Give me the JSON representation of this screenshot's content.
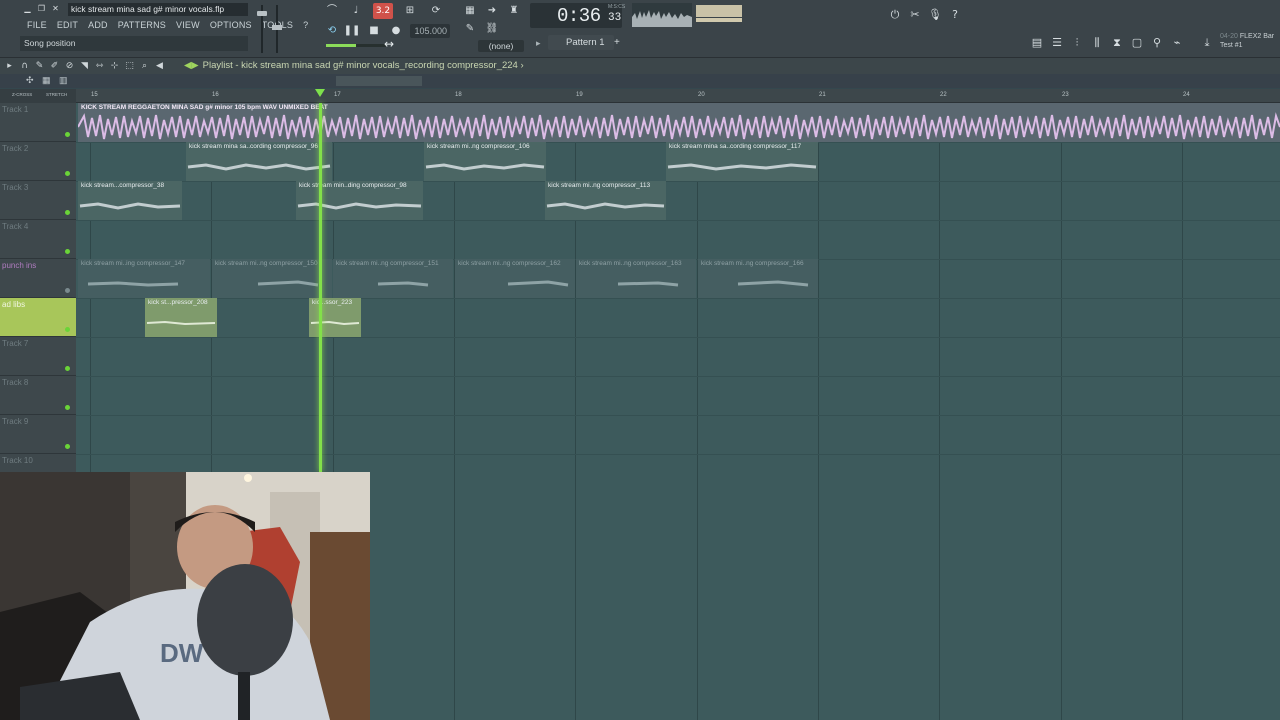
{
  "window": {
    "file_title": "kick stream mina sad g# minor vocals.flp"
  },
  "menu": [
    "FILE",
    "EDIT",
    "ADD",
    "PATTERNS",
    "VIEW",
    "OPTIONS",
    "TOOLS",
    "?"
  ],
  "hint": "Song position",
  "transport": {
    "countdown_label": "3.2",
    "tempo": "105.000",
    "time": "0:36",
    "time_sub": "33",
    "time_unit": "M:S:CS",
    "snap": "(none)"
  },
  "pattern": {
    "label": "Pattern 1"
  },
  "news": {
    "date": "04-20",
    "line1": "FLEX2 Bar",
    "line2": "Test #1"
  },
  "playlist": {
    "title": "Playlist - kick stream mina sad g# minor vocals_recording compressor_224",
    "title_suffix": "›",
    "z_label": "Z-CROSS",
    "s_label": "STRETCH"
  },
  "bars": [
    "15",
    "16",
    "17",
    "18",
    "19",
    "20",
    "21",
    "22",
    "23",
    "24"
  ],
  "tracks": [
    {
      "name": "Track 1"
    },
    {
      "name": "Track 2"
    },
    {
      "name": "Track 3"
    },
    {
      "name": "Track 4"
    },
    {
      "name": "punch ins"
    },
    {
      "name": "ad libs"
    },
    {
      "name": "Track 7"
    },
    {
      "name": "Track 8"
    },
    {
      "name": "Track 9"
    },
    {
      "name": "Track 10"
    }
  ],
  "clips": {
    "main": "KICK STREAM REGGAETON MINA SAD g# minor 105 bpm WAV UNMIXED BEAT",
    "t2": [
      "kick stream mina sa..cording compressor_96",
      "kick stream mi..ng compressor_106",
      "kick stream mina sa..cording compressor_117"
    ],
    "t3": [
      "kick stream...compressor_38",
      "kick stream min..ding compressor_98",
      "kick stream mi..ng compressor_113"
    ],
    "punch": [
      "kick stream mi..ing compressor_147",
      "kick stream mi..ng compressor_150",
      "kick stream mi..ng compressor_151",
      "kick stream mi..ng compressor_162",
      "kick stream mi..ng compressor_163",
      "kick stream mi..ng compressor_166"
    ],
    "adlibs": [
      "kick st...pressor_208",
      "kic...ssor_223"
    ]
  },
  "colors": {
    "accent_green": "#83e04a",
    "track_selected": "#a8c65a",
    "main_wave": "#d9b7e4",
    "grid_bg": "#3d5a5c",
    "record_red": "#d0524a"
  }
}
